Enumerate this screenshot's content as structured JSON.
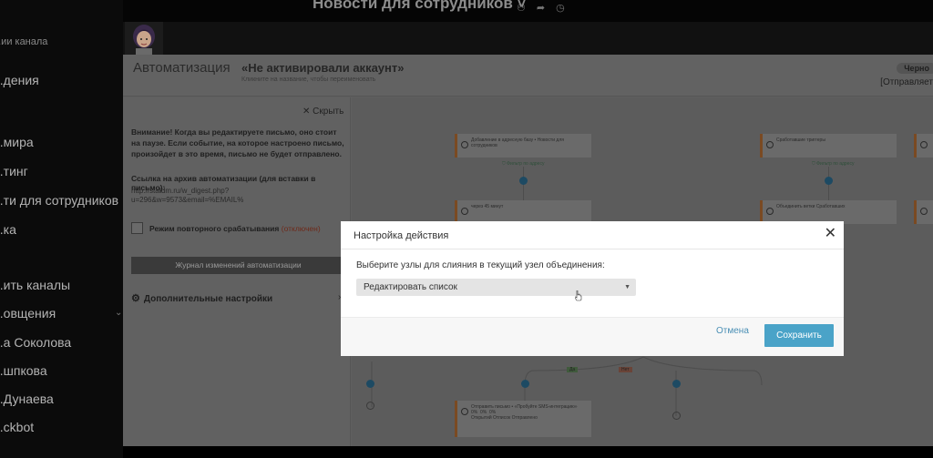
{
  "app_sidebar": {
    "items": [
      {
        "label": "...ии канала",
        "small": true
      },
      {
        "label": "...дения",
        "small": false
      },
      {
        "label": "...мира",
        "small": false
      },
      {
        "label": "...тинг",
        "small": false
      },
      {
        "label": "...ти для сотрудников",
        "small": false
      },
      {
        "label": "...ка",
        "small": false
      },
      {
        "label": "...ить каналы",
        "small": false
      },
      {
        "label": "...овщения",
        "small": false
      },
      {
        "label": "...а Соколова",
        "small": false
      },
      {
        "label": "...шпкова",
        "small": false
      },
      {
        "label": "...Дунаева",
        "small": false
      },
      {
        "label": "...ckbot",
        "small": false
      }
    ]
  },
  "top_bar": {
    "title": "Новости для сотрудников ˅",
    "icons": [
      "user-plus-icon",
      "forward-icon",
      "clock-icon"
    ]
  },
  "header": {
    "section_title": "Автоматизация",
    "automation_name": "«Не активировали аккаунт»",
    "rename_hint": "Кликните на название, чтобы переименовать",
    "status_badge": "Черно",
    "send_mode": "[Отправляет"
  },
  "settings": {
    "hide_label": "Скрыть",
    "warning": "Внимание! Когда вы редактируете письмо, оно стоит на паузе. Если событие, на которое настроено письмо, произойдет в это время, письмо не будет отправлено.",
    "archive_label": "Ссылка на архив автоматизации (для вставки в письмо):",
    "archive_url": "http://statdm.ru/w_digest.php?u=296&w=9573&email=%EMAIL%",
    "repeat_label": "Режим повторного срабатывания",
    "repeat_status": "(отключен)",
    "journal_button": "Журнал изменений автоматизации",
    "advanced_label": "Дополнительные настройки"
  },
  "canvas": {
    "nodes": [
      {
        "text": "Добавление в адресную базу • Новости для сотрудников"
      },
      {
        "text": "Сработавшие триггеры"
      },
      {
        "text": "через 45 минут"
      },
      {
        "text": "Объединить ветки"
      },
      {
        "text": "Отправить письмо • «Пробуйте SMS-интеграцию»"
      }
    ],
    "filter_label": "Фильтр по адресу",
    "merged_label": "Сработавших",
    "yes_label": "Да",
    "no_label": "Нет",
    "stats": [
      "0%",
      "0%",
      "0%"
    ],
    "stat_labels": [
      "Открытий",
      "Отписок",
      "Отправлено"
    ]
  },
  "modal": {
    "title": "Настройка действия",
    "prompt": "Выберите узлы для слияния в текущий узел объединения:",
    "select_value": "Редактировать список",
    "cancel_label": "Отмена",
    "save_label": "Сохранить",
    "accent_color": "#4aa3c8"
  }
}
